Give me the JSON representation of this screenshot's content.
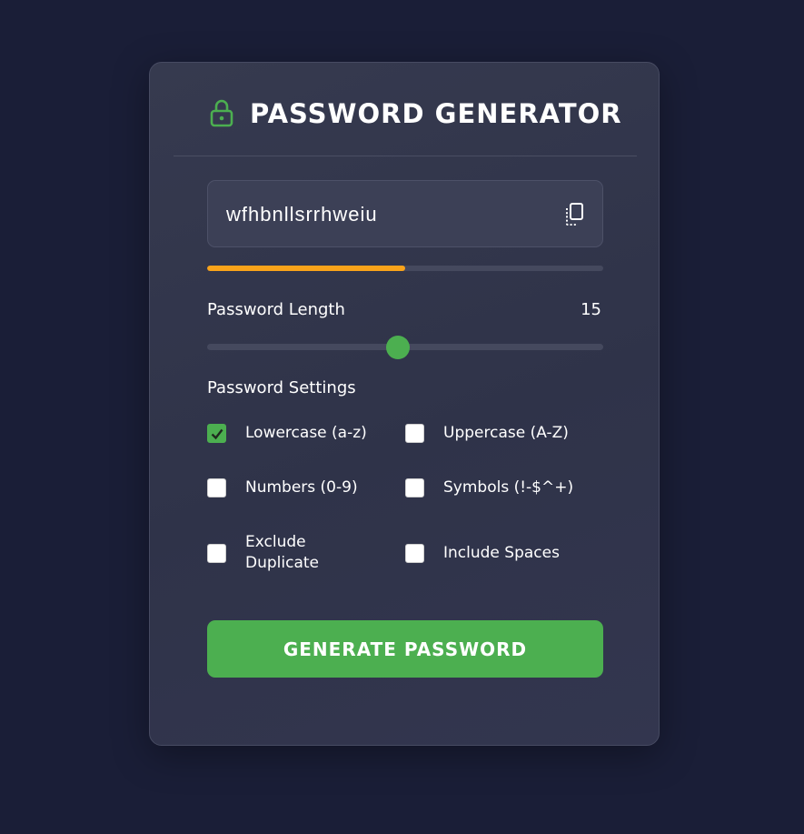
{
  "header": {
    "title": "PASSWORD GENERATOR",
    "icon": "lock-icon"
  },
  "password": {
    "value": "wfhbnllsrrhweiu",
    "copy_icon": "copy-icon"
  },
  "strength": {
    "fraction": 0.5,
    "color": "#f9a31a"
  },
  "length": {
    "label": "Password Length",
    "value": "15",
    "min": 1,
    "max": 30
  },
  "settings": {
    "label": "Password Settings",
    "options": [
      {
        "label": "Lowercase (a-z)",
        "checked": true
      },
      {
        "label": "Uppercase (A-Z)",
        "checked": false
      },
      {
        "label": "Numbers (0-9)",
        "checked": false
      },
      {
        "label": "Symbols (!-$^+)",
        "checked": false
      },
      {
        "label": "Exclude Duplicate",
        "checked": false
      },
      {
        "label": "Include Spaces",
        "checked": false
      }
    ]
  },
  "generate_button": {
    "label": "GENERATE PASSWORD"
  },
  "colors": {
    "accent": "#4caf50",
    "background": "#1a1e37",
    "card": "#33364f"
  }
}
